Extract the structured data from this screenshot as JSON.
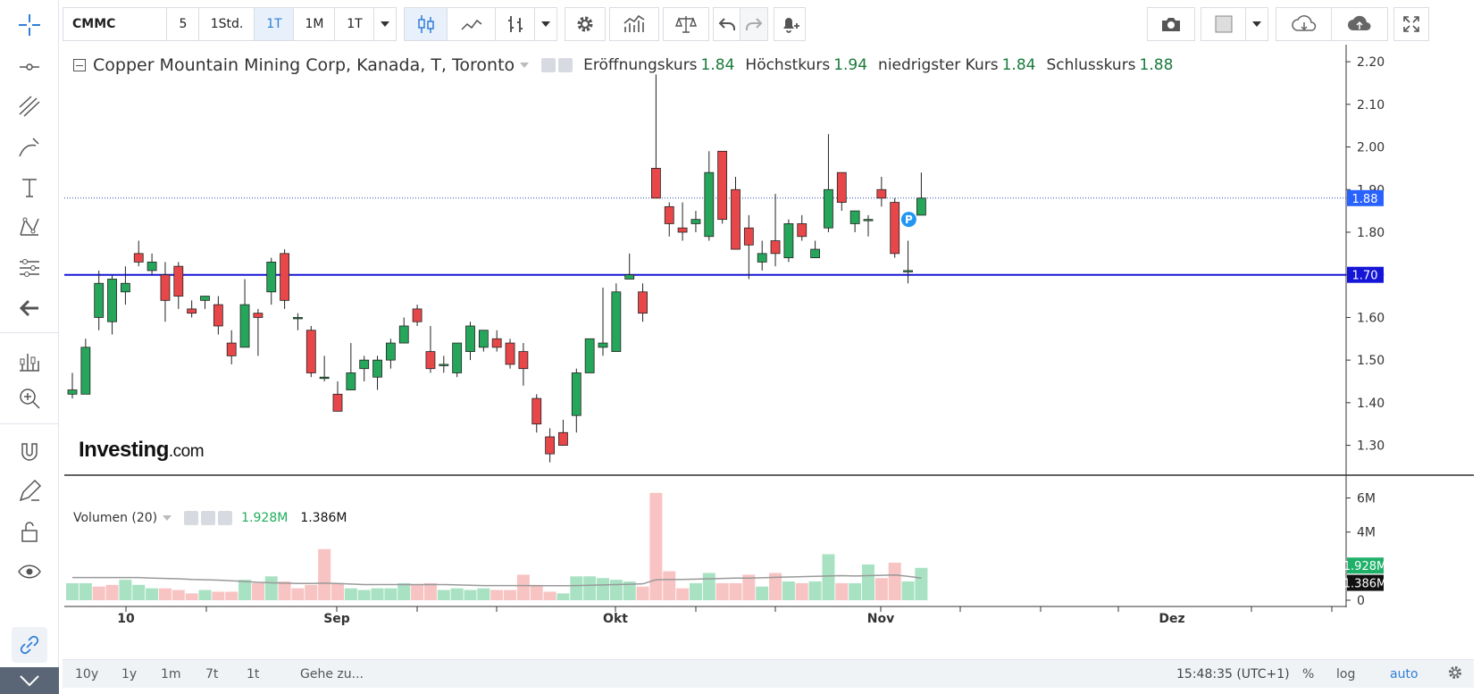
{
  "toolbar": {
    "symbol": "CMMC",
    "intervals": [
      "5",
      "1Std.",
      "1T",
      "1M",
      "1T"
    ],
    "selected_interval": "1T"
  },
  "legend": {
    "title": "Copper Mountain Mining Corp, Kanada, T, Toronto",
    "open_label": "Eröffnungskurs",
    "open": "1.84",
    "high_label": "Höchstkurs",
    "high": "1.94",
    "low_label": "niedrigster Kurs",
    "low": "1.84",
    "close_label": "Schlusskurs",
    "close": "1.88"
  },
  "volume_legend": {
    "label": "Volumen (20)",
    "value1": "1.928M",
    "value2": "1.386M"
  },
  "logo": {
    "main": "Investing",
    "suffix": ".com"
  },
  "bottom_bar": {
    "ranges": [
      "10y",
      "1y",
      "1m",
      "7t",
      "1t"
    ],
    "goto": "Gehe zu...",
    "clock": "15:48:35 (UTC+1)",
    "percent": "%",
    "log": "log",
    "auto": "auto"
  },
  "colors": {
    "up": "#26a65b",
    "down": "#e8474a",
    "accent": "#2f7ed8",
    "hline": "#1515d8"
  },
  "chart_data": {
    "type": "candlestick",
    "title": "Copper Mountain Mining Corp, Kanada, T, Toronto",
    "price_axis": {
      "ticks": [
        1.3,
        1.4,
        1.5,
        1.6,
        1.7,
        1.8,
        1.9,
        2.0,
        2.1,
        2.2
      ],
      "ylim": [
        1.23,
        2.24
      ]
    },
    "price_labels": {
      "current": "1.88",
      "horizontal_line": "1.70"
    },
    "horizontal_line": 1.7,
    "last_price": 1.88,
    "x_labels": [
      "10",
      "Sep",
      "Okt",
      "Nov",
      "Dez"
    ],
    "candles": [
      {
        "o": 1.42,
        "h": 1.47,
        "l": 1.41,
        "c": 1.43
      },
      {
        "o": 1.42,
        "h": 1.55,
        "l": 1.42,
        "c": 1.53
      },
      {
        "o": 1.6,
        "h": 1.71,
        "l": 1.57,
        "c": 1.68
      },
      {
        "o": 1.59,
        "h": 1.7,
        "l": 1.56,
        "c": 1.69
      },
      {
        "o": 1.66,
        "h": 1.72,
        "l": 1.63,
        "c": 1.68
      },
      {
        "o": 1.75,
        "h": 1.78,
        "l": 1.72,
        "c": 1.73
      },
      {
        "o": 1.71,
        "h": 1.75,
        "l": 1.7,
        "c": 1.73
      },
      {
        "o": 1.7,
        "h": 1.73,
        "l": 1.59,
        "c": 1.64
      },
      {
        "o": 1.72,
        "h": 1.73,
        "l": 1.62,
        "c": 1.65
      },
      {
        "o": 1.62,
        "h": 1.64,
        "l": 1.6,
        "c": 1.61
      },
      {
        "o": 1.64,
        "h": 1.65,
        "l": 1.62,
        "c": 1.65
      },
      {
        "o": 1.63,
        "h": 1.65,
        "l": 1.56,
        "c": 1.58
      },
      {
        "o": 1.54,
        "h": 1.57,
        "l": 1.49,
        "c": 1.51
      },
      {
        "o": 1.53,
        "h": 1.69,
        "l": 1.53,
        "c": 1.63
      },
      {
        "o": 1.61,
        "h": 1.62,
        "l": 1.51,
        "c": 1.6
      },
      {
        "o": 1.66,
        "h": 1.74,
        "l": 1.63,
        "c": 1.73
      },
      {
        "o": 1.75,
        "h": 1.76,
        "l": 1.62,
        "c": 1.64
      },
      {
        "o": 1.6,
        "h": 1.61,
        "l": 1.57,
        "c": 1.6
      },
      {
        "o": 1.57,
        "h": 1.58,
        "l": 1.46,
        "c": 1.47
      },
      {
        "o": 1.46,
        "h": 1.51,
        "l": 1.45,
        "c": 1.46
      },
      {
        "o": 1.42,
        "h": 1.45,
        "l": 1.38,
        "c": 1.38
      },
      {
        "o": 1.43,
        "h": 1.54,
        "l": 1.43,
        "c": 1.47
      },
      {
        "o": 1.48,
        "h": 1.51,
        "l": 1.45,
        "c": 1.5
      },
      {
        "o": 1.46,
        "h": 1.51,
        "l": 1.43,
        "c": 1.5
      },
      {
        "o": 1.5,
        "h": 1.55,
        "l": 1.48,
        "c": 1.54
      },
      {
        "o": 1.54,
        "h": 1.6,
        "l": 1.54,
        "c": 1.58
      },
      {
        "o": 1.62,
        "h": 1.63,
        "l": 1.58,
        "c": 1.59
      },
      {
        "o": 1.52,
        "h": 1.58,
        "l": 1.47,
        "c": 1.48
      },
      {
        "o": 1.49,
        "h": 1.51,
        "l": 1.47,
        "c": 1.49
      },
      {
        "o": 1.47,
        "h": 1.54,
        "l": 1.46,
        "c": 1.54
      },
      {
        "o": 1.52,
        "h": 1.59,
        "l": 1.5,
        "c": 1.58
      },
      {
        "o": 1.53,
        "h": 1.57,
        "l": 1.52,
        "c": 1.57
      },
      {
        "o": 1.55,
        "h": 1.57,
        "l": 1.52,
        "c": 1.53
      },
      {
        "o": 1.54,
        "h": 1.55,
        "l": 1.48,
        "c": 1.49
      },
      {
        "o": 1.52,
        "h": 1.54,
        "l": 1.44,
        "c": 1.48
      },
      {
        "o": 1.41,
        "h": 1.42,
        "l": 1.33,
        "c": 1.35
      },
      {
        "o": 1.32,
        "h": 1.34,
        "l": 1.26,
        "c": 1.28
      },
      {
        "o": 1.33,
        "h": 1.36,
        "l": 1.3,
        "c": 1.3
      },
      {
        "o": 1.37,
        "h": 1.48,
        "l": 1.33,
        "c": 1.47
      },
      {
        "o": 1.47,
        "h": 1.55,
        "l": 1.47,
        "c": 1.55
      },
      {
        "o": 1.53,
        "h": 1.67,
        "l": 1.51,
        "c": 1.54
      },
      {
        "o": 1.52,
        "h": 1.68,
        "l": 1.52,
        "c": 1.66
      },
      {
        "o": 1.69,
        "h": 1.75,
        "l": 1.69,
        "c": 1.7
      },
      {
        "o": 1.66,
        "h": 1.68,
        "l": 1.59,
        "c": 1.61
      },
      {
        "o": 1.95,
        "h": 2.17,
        "l": 1.88,
        "c": 1.88
      },
      {
        "o": 1.86,
        "h": 1.87,
        "l": 1.79,
        "c": 1.82
      },
      {
        "o": 1.81,
        "h": 1.87,
        "l": 1.78,
        "c": 1.8
      },
      {
        "o": 1.82,
        "h": 1.85,
        "l": 1.8,
        "c": 1.83
      },
      {
        "o": 1.79,
        "h": 1.99,
        "l": 1.78,
        "c": 1.94
      },
      {
        "o": 1.99,
        "h": 1.99,
        "l": 1.82,
        "c": 1.83
      },
      {
        "o": 1.9,
        "h": 1.93,
        "l": 1.76,
        "c": 1.76
      },
      {
        "o": 1.81,
        "h": 1.84,
        "l": 1.69,
        "c": 1.77
      },
      {
        "o": 1.73,
        "h": 1.78,
        "l": 1.71,
        "c": 1.75
      },
      {
        "o": 1.78,
        "h": 1.89,
        "l": 1.72,
        "c": 1.75
      },
      {
        "o": 1.74,
        "h": 1.83,
        "l": 1.73,
        "c": 1.82
      },
      {
        "o": 1.82,
        "h": 1.84,
        "l": 1.78,
        "c": 1.79
      },
      {
        "o": 1.74,
        "h": 1.78,
        "l": 1.74,
        "c": 1.76
      },
      {
        "o": 1.81,
        "h": 2.03,
        "l": 1.8,
        "c": 1.9
      },
      {
        "o": 1.94,
        "h": 1.94,
        "l": 1.85,
        "c": 1.87
      },
      {
        "o": 1.82,
        "h": 1.85,
        "l": 1.8,
        "c": 1.85
      },
      {
        "o": 1.83,
        "h": 1.84,
        "l": 1.79,
        "c": 1.83
      },
      {
        "o": 1.9,
        "h": 1.93,
        "l": 1.86,
        "c": 1.88
      },
      {
        "o": 1.87,
        "h": 1.88,
        "l": 1.74,
        "c": 1.75
      },
      {
        "o": 1.71,
        "h": 1.78,
        "l": 1.68,
        "c": 1.71
      },
      {
        "o": 1.84,
        "h": 1.94,
        "l": 1.84,
        "c": 1.88
      }
    ],
    "volume": {
      "axis_ticks": [
        "0",
        "2M",
        "4M",
        "6M"
      ],
      "ylim": [
        0,
        6.5
      ],
      "values": [
        1.0,
        1.0,
        0.8,
        0.9,
        1.2,
        0.9,
        0.7,
        0.7,
        0.6,
        0.4,
        0.6,
        0.5,
        0.5,
        1.2,
        1.0,
        1.4,
        1.1,
        0.7,
        0.9,
        3.0,
        1.0,
        0.7,
        0.6,
        0.7,
        0.7,
        1.0,
        0.9,
        1.0,
        0.6,
        0.7,
        0.6,
        0.7,
        0.6,
        0.6,
        1.5,
        0.9,
        0.5,
        0.4,
        1.4,
        1.4,
        1.3,
        1.2,
        1.1,
        0.8,
        6.3,
        1.7,
        0.7,
        1.0,
        1.6,
        1.0,
        1.0,
        1.5,
        0.8,
        1.6,
        1.1,
        1.0,
        1.1,
        2.7,
        1.0,
        1.0,
        2.1,
        1.3,
        2.2,
        1.1,
        1.9
      ],
      "up": [
        1,
        1,
        0,
        0,
        1,
        1,
        1,
        0,
        0,
        0,
        1,
        0,
        0,
        1,
        0,
        1,
        0,
        0,
        0,
        0,
        0,
        1,
        1,
        1,
        1,
        1,
        0,
        0,
        1,
        1,
        1,
        1,
        0,
        0,
        0,
        0,
        0,
        1,
        1,
        1,
        1,
        1,
        1,
        0,
        0,
        0,
        0,
        1,
        1,
        0,
        0,
        0,
        1,
        0,
        1,
        0,
        1,
        1,
        0,
        1,
        1,
        0,
        0,
        1,
        1
      ],
      "ma": [
        1.33,
        1.33,
        1.33,
        1.33,
        1.33,
        1.33,
        1.3,
        1.28,
        1.26,
        1.22,
        1.2,
        1.18,
        1.14,
        1.1,
        1.05,
        1.02,
        1.0,
        0.98,
        0.98,
        1.0,
        0.98,
        0.95,
        0.92,
        0.92,
        0.92,
        0.92,
        0.92,
        0.92,
        0.92,
        0.9,
        0.88,
        0.86,
        0.86,
        0.86,
        0.86,
        0.85,
        0.85,
        0.85,
        0.86,
        0.88,
        0.9,
        0.92,
        0.94,
        0.96,
        1.2,
        1.22,
        1.22,
        1.24,
        1.26,
        1.28,
        1.3,
        1.3,
        1.32,
        1.34,
        1.36,
        1.38,
        1.4,
        1.42,
        1.44,
        1.42,
        1.44,
        1.46,
        1.48,
        1.4,
        1.3
      ],
      "labels": {
        "current_green": "1.928M",
        "current_black": "1.386M"
      }
    }
  }
}
